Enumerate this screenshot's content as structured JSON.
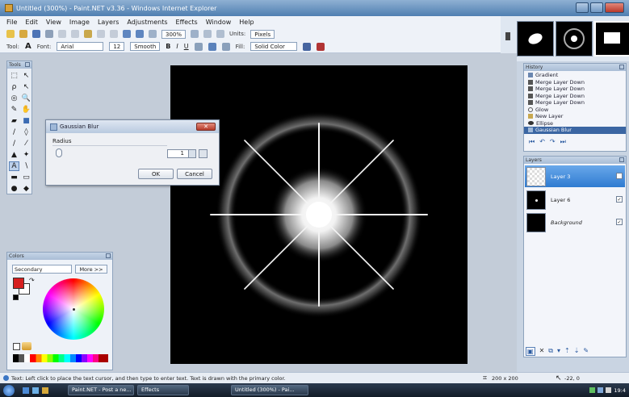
{
  "window": {
    "title": "Untitled (300%) - Paint.NET v3.36 - Windows Internet Explorer"
  },
  "menu": [
    "File",
    "Edit",
    "View",
    "Image",
    "Layers",
    "Adjustments",
    "Effects",
    "Window",
    "Help"
  ],
  "toolbar": {
    "zoom_value": "300%",
    "units_label": "Units:",
    "units_value": "Pixels"
  },
  "text_toolbar": {
    "tool_label": "Tool:",
    "font_label": "Font:",
    "font_value": "Arial",
    "size_value": "12",
    "antialias_value": "Smooth",
    "bold": "B",
    "italic": "I",
    "underline": "U",
    "fill_label": "Fill:",
    "fill_value": "Solid Color"
  },
  "tools_panel": {
    "title": "Tools"
  },
  "blur_dialog": {
    "title": "Gaussian Blur",
    "radius_label": "Radius",
    "radius_value": "1",
    "ok_label": "OK",
    "cancel_label": "Cancel"
  },
  "colors_panel": {
    "title": "Colors",
    "mode_value": "Secondary",
    "more_label": "More >>",
    "primary_color": "#d61f1f",
    "secondary_color": "#ffffff"
  },
  "history_panel": {
    "title": "History",
    "items": [
      {
        "label": "Gradient"
      },
      {
        "label": "Merge Layer Down"
      },
      {
        "label": "Merge Layer Down"
      },
      {
        "label": "Merge Layer Down"
      },
      {
        "label": "Merge Layer Down"
      },
      {
        "label": "Glow"
      },
      {
        "label": "New Layer"
      },
      {
        "label": "Ellipse"
      },
      {
        "label": "Gaussian Blur"
      }
    ]
  },
  "layers_panel": {
    "title": "Layers",
    "layers": [
      {
        "name": "Layer 3"
      },
      {
        "name": "Layer 6"
      },
      {
        "name": "Background"
      }
    ]
  },
  "status_bar": {
    "hint": "Text: Left click to place the text cursor, and then type to enter text. Text is drawn with the primary color.",
    "image_size": "200 x 200",
    "cursor_pos": "-22, 0"
  },
  "taskbar": {
    "items": [
      {
        "label": "Paint.NET - Post a ne..."
      },
      {
        "label": "Effects"
      },
      {
        "label": "Untitled (300%) - Pai..."
      }
    ],
    "clock": "19:4"
  }
}
